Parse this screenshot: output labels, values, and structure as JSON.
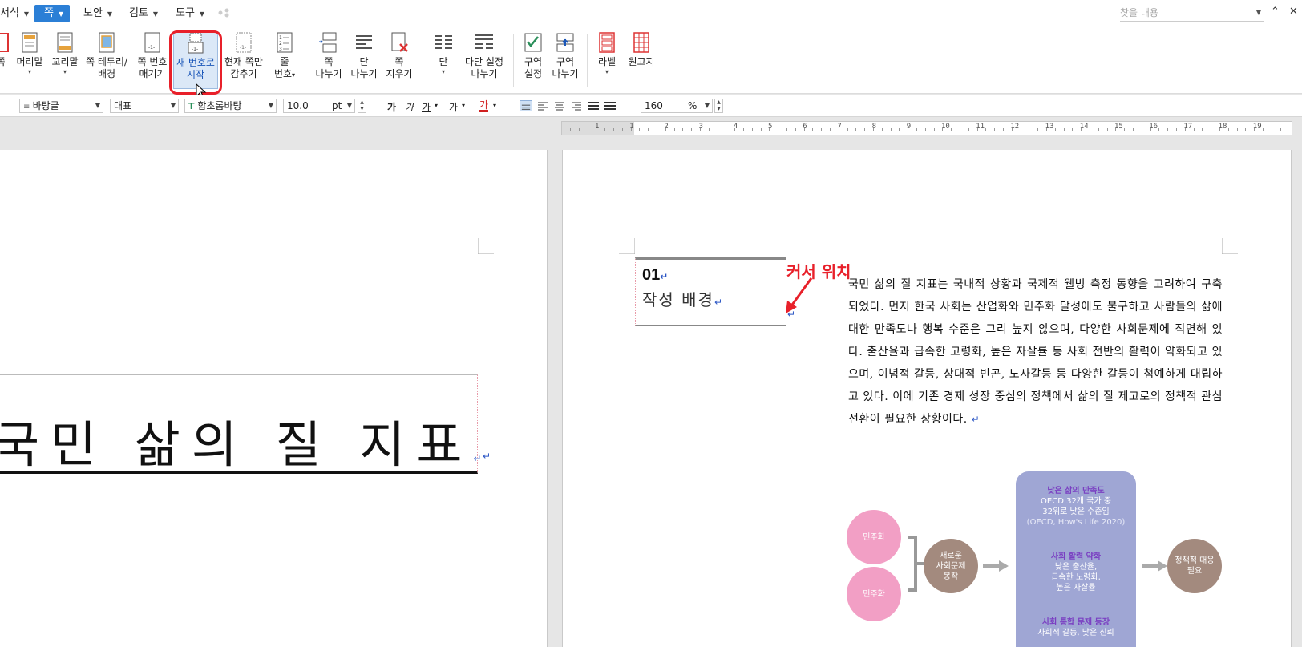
{
  "menubar": {
    "items": [
      {
        "label": "서식",
        "active": false
      },
      {
        "label": "쪽",
        "active": true
      },
      {
        "label": "보안",
        "active": false
      },
      {
        "label": "검토",
        "active": false
      },
      {
        "label": "도구",
        "active": false
      }
    ],
    "search_placeholder": "찾을 내용"
  },
  "ribbon": {
    "buttons": [
      {
        "line1": "쪽",
        "line2": "",
        "icon": "page-icon"
      },
      {
        "line1": "머리말",
        "line2": "",
        "icon": "header-icon",
        "dropdown": true
      },
      {
        "line1": "꼬리말",
        "line2": "",
        "icon": "footer-icon",
        "dropdown": true
      },
      {
        "line1": "쪽 테두리/",
        "line2": "배경",
        "icon": "page-border-icon"
      },
      {
        "line1": "쪽 번호",
        "line2": "매기기",
        "icon": "page-number-icon"
      },
      {
        "line1": "새 번호로",
        "line2": "시작",
        "icon": "new-number-icon",
        "selected": true
      },
      {
        "line1": "현재 쪽만",
        "line2": "감추기",
        "icon": "hide-current-page-icon"
      },
      {
        "line1": "줄",
        "line2": "번호",
        "icon": "line-number-icon",
        "dropdown_inline": true
      },
      {
        "line1": "쪽",
        "line2": "나누기",
        "icon": "page-break-icon"
      },
      {
        "line1": "단",
        "line2": "나누기",
        "icon": "column-break-icon"
      },
      {
        "line1": "쪽",
        "line2": "지우기",
        "icon": "delete-page-icon"
      },
      {
        "line1": "단",
        "line2": "",
        "icon": "columns-icon",
        "dropdown": true
      },
      {
        "line1": "다단 설정",
        "line2": "나누기",
        "icon": "multi-column-icon"
      },
      {
        "line1": "구역",
        "line2": "설정",
        "icon": "section-settings-icon"
      },
      {
        "line1": "구역",
        "line2": "나누기",
        "icon": "section-break-icon"
      },
      {
        "line1": "라벨",
        "line2": "",
        "icon": "label-icon",
        "dropdown": true
      },
      {
        "line1": "원고지",
        "line2": "",
        "icon": "manuscript-icon"
      }
    ]
  },
  "format": {
    "style": "바탕글",
    "font_lang": "대표",
    "font": "함초롬바탕",
    "size": "10.0",
    "unit": "pt",
    "bold": "가",
    "italic": "가",
    "underline": "가",
    "strike": "가",
    "color": "가",
    "zoom": "160",
    "zoom_unit": "%",
    "accent": "#d02020"
  },
  "ruler": {
    "labels": [
      "1",
      "1",
      "2",
      "3",
      "4",
      "5",
      "6",
      "7",
      "8",
      "9",
      "10",
      "11",
      "12",
      "13",
      "14",
      "15",
      "16",
      "17",
      "18",
      "19"
    ]
  },
  "left_page": {
    "title": "국민 삶의 질 지표"
  },
  "right_page": {
    "heading_number": "01",
    "heading_text": "작성 배경",
    "annotation": "커서 위치",
    "paragraph": "국민 삶의 질 지표는 국내적 상황과 국제적 웰빙 측정 동향을 고려하여 구축되었다. 먼저 한국 사회는 산업화와 민주화 달성에도 불구하고 사람들의 삶에 대한 만족도나 행복 수준은 그리 높지 않으며, 다양한 사회문제에 직면해 있다. 출산율과 급속한 고령화, 높은 자살률 등 사회 전반의 활력이 약화되고 있으며, 이념적 갈등, 상대적 빈곤, 노사갈등 등 다양한 갈등이 첨예하게 대립하고 있다. 이에 기존 경제 성장 중심의 정책에서 삶의 질 제고로의 정책적 관심 전환이 필요한 상황이다.",
    "diagram": {
      "circle_top": "민주화",
      "circle_bottom": "민주화",
      "middle_circle": "새로운\n사회문제\n봉착",
      "panel": [
        {
          "title": "낮은 삶의 만족도",
          "body": "OECD 32개 국가 중\n32위로 낮은 수준임",
          "source": "(OECD, How's Life 2020)"
        },
        {
          "title": "사회 활력 약화",
          "body": "낮은 출산율,\n급속한 노령화,\n높은 자살률",
          "source": ""
        },
        {
          "title": "사회 통합 문제 등장",
          "body": "사회적 갈등, 낮은 신뢰",
          "source": ""
        }
      ],
      "result_circle": "정책적 대응\n필요",
      "colors": {
        "pink": "#f29fc5",
        "brown": "#a38a7e",
        "panel": "#9fa6d4",
        "panel_title": "#7a3fc2"
      }
    }
  }
}
